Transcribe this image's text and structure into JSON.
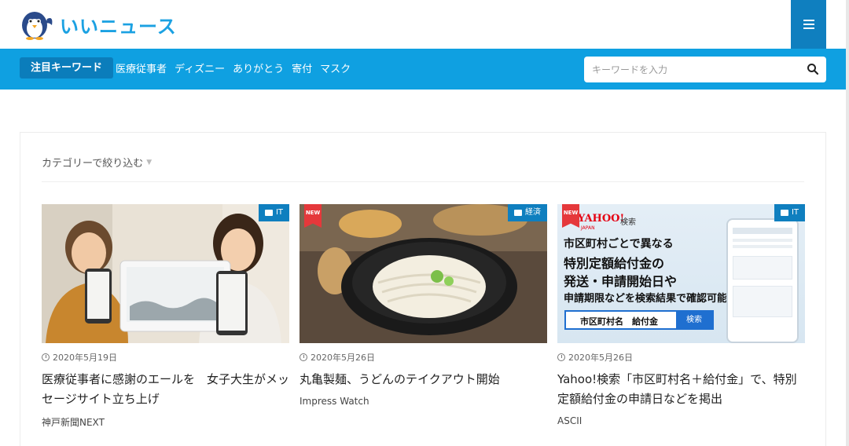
{
  "header": {
    "site_name": "いいニュース",
    "menu_icon": "hamburger-icon"
  },
  "nav": {
    "keyword_label": "注目キーワード",
    "keywords": [
      "医療従事者",
      "ディズニー",
      "ありがとう",
      "寄付",
      "マスク"
    ],
    "search_placeholder": "キーワードを入力",
    "search_icon": "search-icon"
  },
  "filter": {
    "label": "カテゴリーで絞り込む"
  },
  "articles": [
    {
      "category": "IT",
      "is_new": false,
      "date": "2020年5月19日",
      "title": "医療従事者に感謝のエールを　女子大生がメッセージサイト立ち上げ",
      "source": "神戸新聞NEXT"
    },
    {
      "category": "経済",
      "is_new": true,
      "new_label": "NEW",
      "date": "2020年5月26日",
      "title": "丸亀製麺、うどんのテイクアウト開始",
      "source": "Impress Watch"
    },
    {
      "category": "IT",
      "is_new": true,
      "new_label": "NEW",
      "date": "2020年5月26日",
      "title": "Yahoo!検索「市区町村名＋給付金」で、特別定額給付金の申請日などを掲出",
      "source": "ASCII",
      "image_text": {
        "brand": "YAHOO!",
        "brand_sub": "JAPAN",
        "brand_search": "検索",
        "line1": "市区町村ごとで異なる",
        "line2": "特別定額給付金の",
        "line3": "発送・申請開始日や",
        "line4": "申請期限などを検索結果で確認可能",
        "search_query": "市区町村名　給付金",
        "search_button": "検索"
      }
    }
  ],
  "colors": {
    "accent": "#0fa0e1",
    "accent_dark": "#0f7fbf",
    "new_badge": "#e5383b"
  }
}
